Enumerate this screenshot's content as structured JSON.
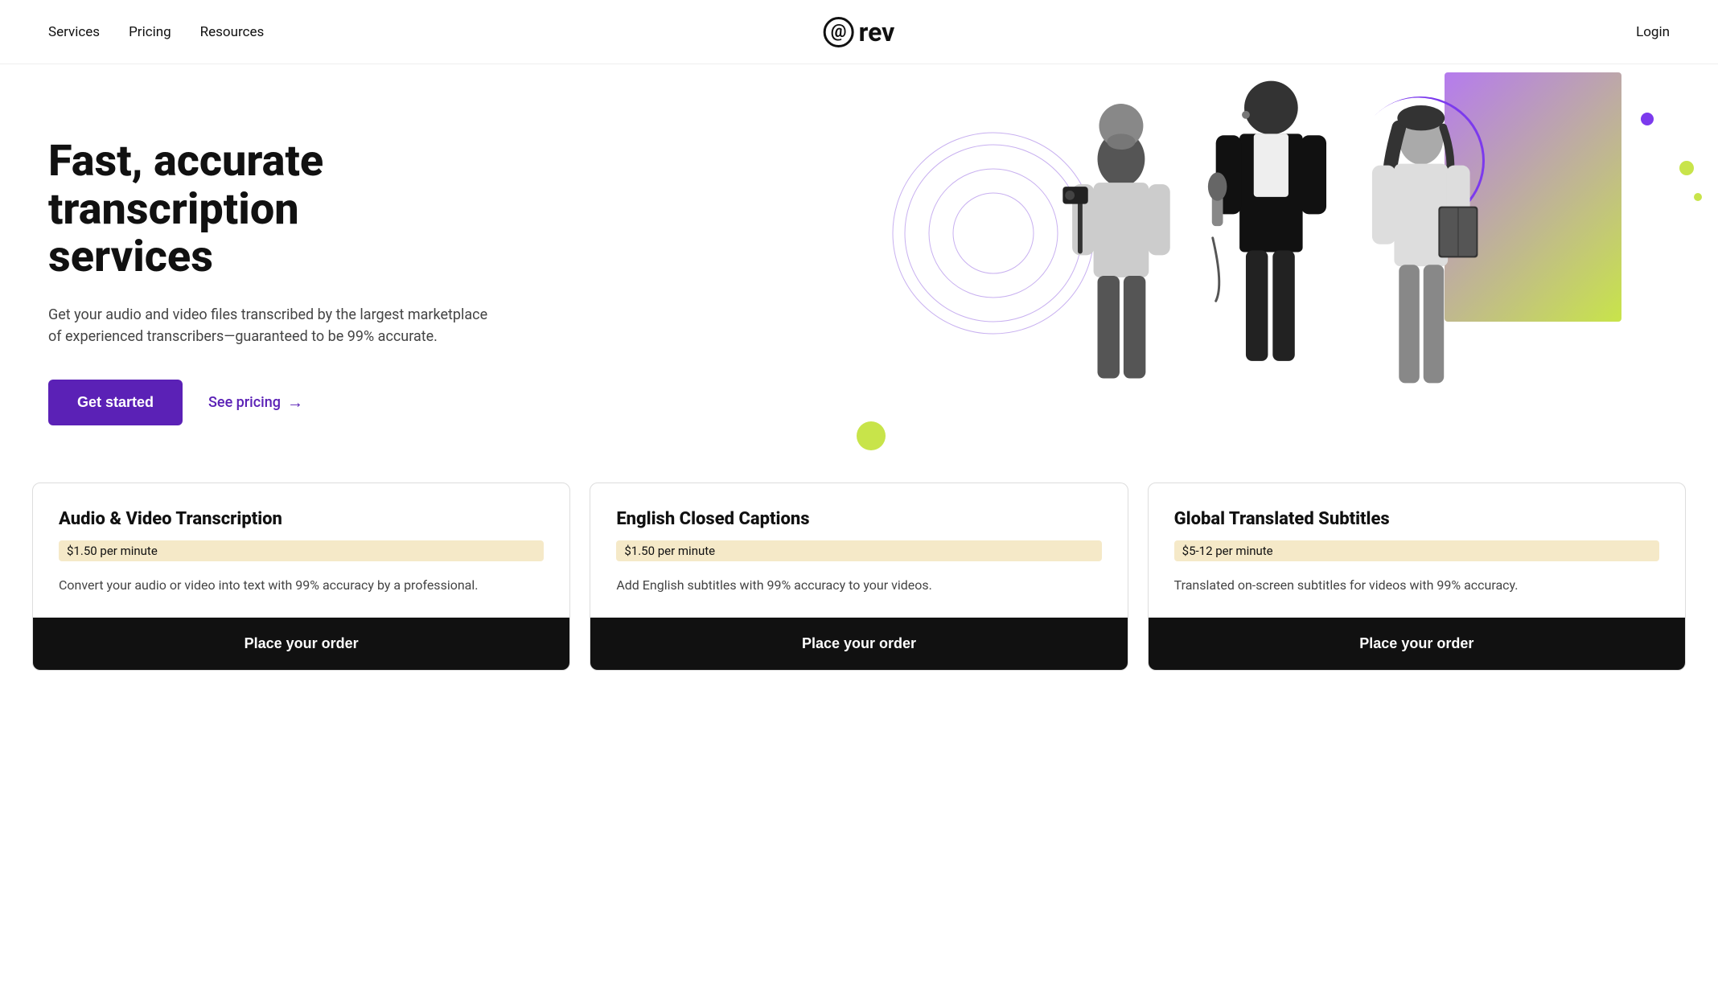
{
  "header": {
    "nav_services": "Services",
    "nav_pricing": "Pricing",
    "nav_resources": "Resources",
    "logo_at": "@",
    "logo_brand": "rev",
    "login": "Login"
  },
  "hero": {
    "heading_line1": "Fast, accurate transcription",
    "heading_line2": "services",
    "description": "Get your audio and video files transcribed by the largest marketplace of experienced transcribers—guaranteed to be 99% accurate.",
    "cta_primary": "Get started",
    "cta_secondary": "See pricing",
    "cta_arrow": "→"
  },
  "cards": [
    {
      "title": "Audio & Video Transcription",
      "price": "$1.50 per minute",
      "description": "Convert your audio or video into text with 99% accuracy by a professional.",
      "button": "Place your order"
    },
    {
      "title": "English Closed Captions",
      "price": "$1.50 per minute",
      "description": "Add English subtitles with 99% accuracy to your videos.",
      "button": "Place your order"
    },
    {
      "title": "Global Translated Subtitles",
      "price": "$5-12 per minute",
      "description": "Translated on-screen subtitles for videos with 99% accuracy.",
      "button": "Place your order"
    }
  ]
}
